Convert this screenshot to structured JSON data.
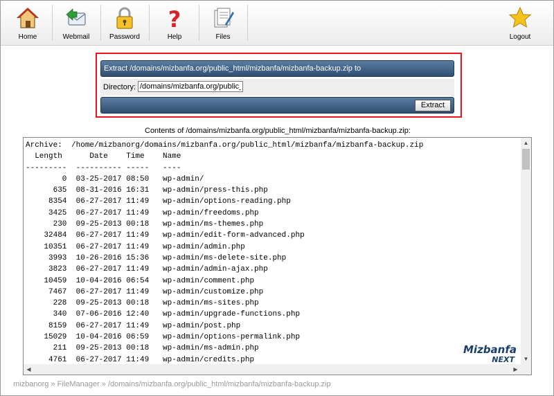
{
  "toolbar": {
    "home": "Home",
    "webmail": "Webmail",
    "password": "Password",
    "help": "Help",
    "files": "Files",
    "logout": "Logout"
  },
  "extract": {
    "title": "Extract /domains/mizbanfa.org/public_html/mizbanfa/mizbanfa-backup.zip to",
    "directory_label": "Directory:",
    "directory_value": "/domains/mizbanfa.org/public_",
    "button": "Extract"
  },
  "contents_title": "Contents of /domains/mizbanfa.org/public_html/mizbanfa/mizbanfa-backup.zip:",
  "archive_text": "Archive:  /home/mizbanorg/domains/mizbanfa.org/public_html/mizbanfa/mizbanfa-backup.zip\n  Length      Date    Time    Name\n---------  ---------- -----   ----\n        0  03-25-2017 08:50   wp-admin/\n      635  08-31-2016 16:31   wp-admin/press-this.php\n     8354  06-27-2017 11:49   wp-admin/options-reading.php\n     3425  06-27-2017 11:49   wp-admin/freedoms.php\n      230  09-25-2013 00:18   wp-admin/ms-themes.php\n    32484  06-27-2017 11:49   wp-admin/edit-form-advanced.php\n    10351  06-27-2017 11:49   wp-admin/admin.php\n     3993  10-26-2016 15:36   wp-admin/ms-delete-site.php\n     3823  06-27-2017 11:49   wp-admin/admin-ajax.php\n    10459  10-04-2016 06:54   wp-admin/comment.php\n     7467  06-27-2017 11:49   wp-admin/customize.php\n      228  09-25-2013 00:18   wp-admin/ms-sites.php\n      340  07-06-2016 12:40   wp-admin/upgrade-functions.php\n     8159  06-27-2017 11:49   wp-admin/post.php\n    15029  10-04-2016 06:59   wp-admin/options-permalink.php\n      211  09-25-2013 00:18   wp-admin/ms-admin.php\n     4761  06-27-2017 11:49   wp-admin/credits.php",
  "logo": {
    "line1": "Mizbanfa",
    "line2": "NEXT"
  },
  "breadcrumb": {
    "user": "mizbanorg",
    "sep1": " » ",
    "filemanager": "FileManager",
    "sep2": " » ",
    "path": "/domains/mizbanfa.org/public_html/mizbanfa/mizbanfa-backup.zip"
  },
  "colors": {
    "bar": "#3d5f85",
    "highlight": "#e8141b"
  }
}
